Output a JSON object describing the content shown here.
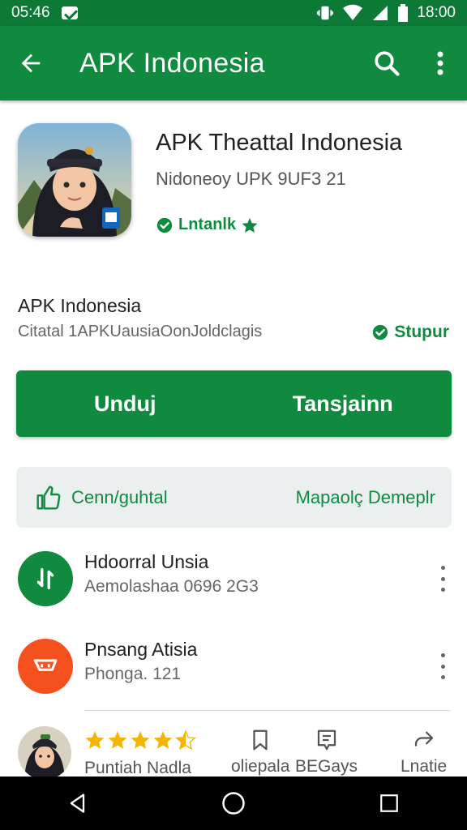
{
  "status_bar": {
    "time_left": "05:46",
    "time_right": "18:00"
  },
  "app_bar": {
    "title": "APK Indonesia"
  },
  "app": {
    "name": "APK Theattal Indonesia",
    "developer": "Nidoneoy UPK 9UF3 21",
    "badge": "Lntanlk"
  },
  "info": {
    "title": "APK Indonesia",
    "subtitle": "Citatal 1APKUausiaOonJoldclagis",
    "link": "Stupur"
  },
  "actions": {
    "primary_left": "Unduj",
    "primary_right": "Tansjainn"
  },
  "secondary": {
    "left": "Cenn/guhtal",
    "right": "Mapaolç Demeplr"
  },
  "list": [
    {
      "title": "Hdoorral Unsia",
      "subtitle": "Aemolashaa 0696 2G3"
    },
    {
      "title": "Pnsang Atisia",
      "subtitle": "Phonga. 121"
    }
  ],
  "bottom": {
    "rating_label": "Puntiah Nadla",
    "rating_value": 4.5,
    "tabs": [
      {
        "label": "oliepala"
      },
      {
        "label": "BEGays"
      },
      {
        "label": "Lnatie"
      }
    ]
  },
  "colors": {
    "primary": "#0f8a3e",
    "status": "#0c7a36",
    "orange": "#f4511e",
    "star": "#f5b400"
  }
}
